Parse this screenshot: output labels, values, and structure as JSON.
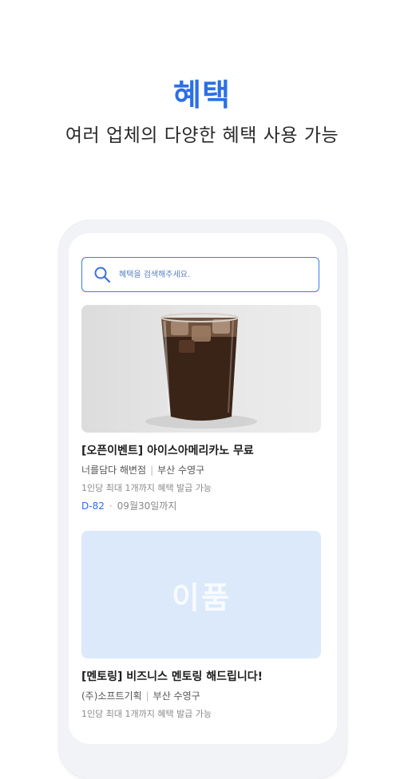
{
  "header": {
    "title": "혜택",
    "subtitle": "여러 업체의 다양한 혜택 사용 가능"
  },
  "search": {
    "placeholder": "혜택을 검색해주세요."
  },
  "benefits": [
    {
      "title": "[오픈이벤트] 아이스아메리카노 무료",
      "store": "너를담다 해변점",
      "location": "부산 수영구",
      "description": "1인당 최대 1개까지 혜택 발급 가능",
      "dday": "D-82",
      "deadline": "09월30일까지"
    },
    {
      "image_text": "이품",
      "title": "[멘토링] 비즈니스 멘토링 해드립니다!",
      "store": "(주)소프트기획",
      "location": "부산 수영구",
      "description": "1인당 최대 1개까지 혜택 발급 가능"
    }
  ],
  "colors": {
    "accent": "#2b6fe6",
    "placeholder_bg": "#dce9fb"
  }
}
